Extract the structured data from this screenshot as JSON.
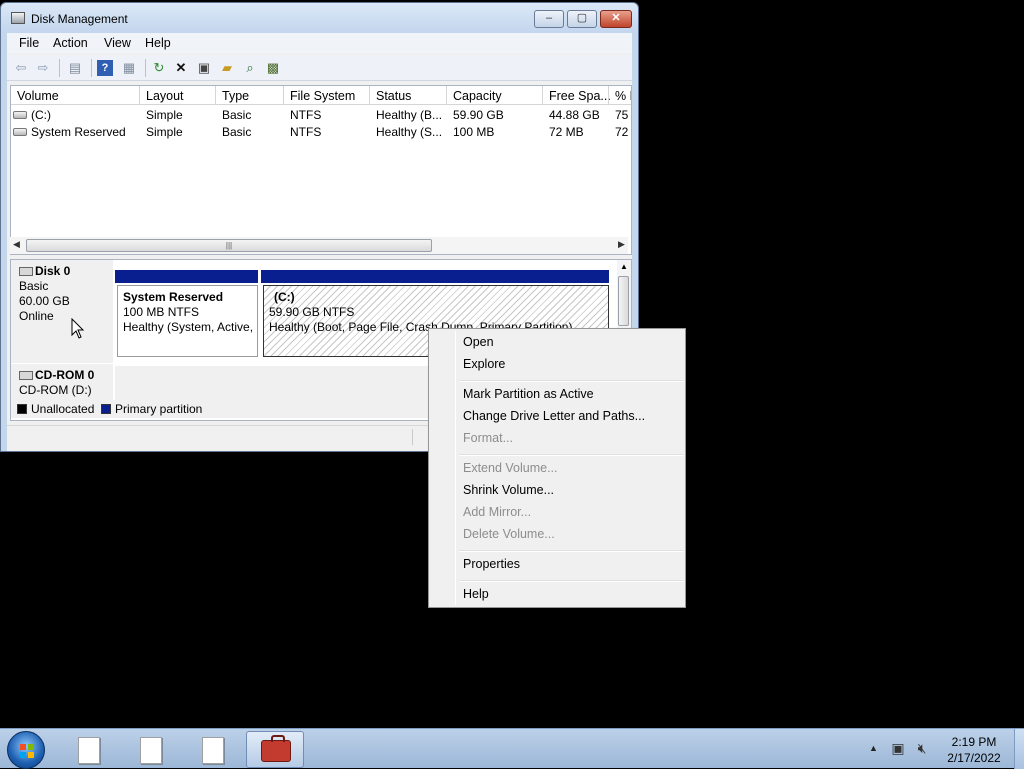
{
  "window": {
    "title": "Disk Management"
  },
  "menubar": [
    "File",
    "Action",
    "View",
    "Help"
  ],
  "toolbar": {
    "icons": [
      "back-icon",
      "forward-icon",
      "show-hide-console-tree-icon",
      "help-icon",
      "properties-view-icon",
      "refresh-icon",
      "delete-icon",
      "properties-icon",
      "open-icon",
      "explore-icon",
      "rescan-icon"
    ]
  },
  "volume_list": {
    "columns": [
      "Volume",
      "Layout",
      "Type",
      "File System",
      "Status",
      "Capacity",
      "Free Spa...",
      "% F"
    ],
    "rows": [
      [
        "(C:)",
        "Simple",
        "Basic",
        "NTFS",
        "Healthy (B...",
        "59.90 GB",
        "44.88 GB",
        "75"
      ],
      [
        "System Reserved",
        "Simple",
        "Basic",
        "NTFS",
        "Healthy (S...",
        "100 MB",
        "72 MB",
        "72"
      ]
    ]
  },
  "disks": [
    {
      "name": "Disk 0",
      "lines": [
        "Basic",
        "60.00 GB",
        "Online"
      ],
      "partitions": [
        {
          "name": "System Reserved",
          "size": "100 MB NTFS",
          "status": "Healthy (System, Active,"
        },
        {
          "name": "(C:)",
          "size": "59.90 GB NTFS",
          "status": "Healthy (Boot, Page File, Crash Dump, Primary Partition)"
        }
      ]
    },
    {
      "name": "CD-ROM 0",
      "lines": [
        "CD-ROM (D:)"
      ]
    }
  ],
  "legend": [
    {
      "label": "Unallocated",
      "color": "#000000"
    },
    {
      "label": "Primary partition",
      "color": "#0a1f8f"
    }
  ],
  "context_menu": {
    "items": [
      {
        "label": "Open",
        "enabled": true
      },
      {
        "label": "Explore",
        "enabled": true
      },
      {
        "label": "Mark Partition as Active",
        "enabled": true
      },
      {
        "label": "Change Drive Letter and Paths...",
        "enabled": true
      },
      {
        "label": "Format...",
        "enabled": false
      },
      {
        "label": "Extend Volume...",
        "enabled": false
      },
      {
        "label": "Shrink Volume...",
        "enabled": true
      },
      {
        "label": "Add Mirror...",
        "enabled": false
      },
      {
        "label": "Delete Volume...",
        "enabled": false
      },
      {
        "label": "Properties",
        "enabled": true
      },
      {
        "label": "Help",
        "enabled": true
      }
    ]
  },
  "taskbar": {
    "buttons": [
      "document-icon",
      "document-icon",
      "document-icon",
      "toolbox-icon"
    ],
    "clock_time": "2:19 PM",
    "clock_date": "2/17/2022"
  }
}
